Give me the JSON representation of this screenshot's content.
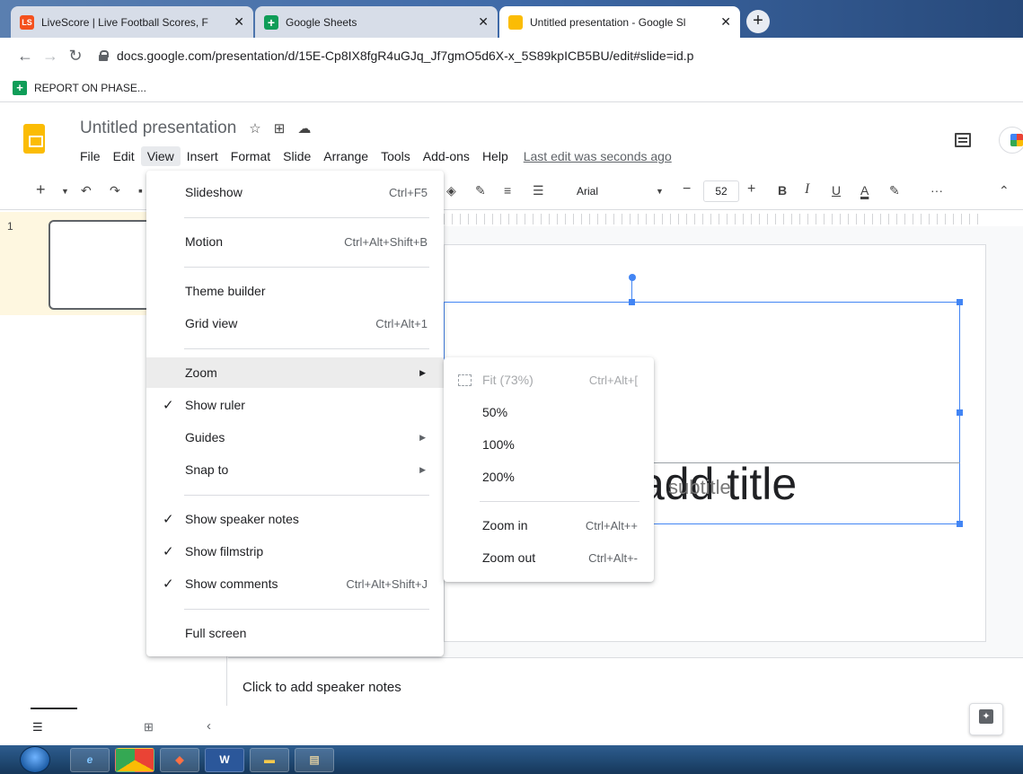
{
  "browser": {
    "tabs": [
      {
        "favicon": "LS",
        "title": "LiveScore | Live Football Scores, F",
        "favicon_color": "#f4511e"
      },
      {
        "favicon": "+",
        "title": "Google Sheets",
        "favicon_color": "#0f9d58"
      },
      {
        "favicon": "",
        "title": "Untitled presentation - Google Sl",
        "favicon_color": "#fbbc04"
      }
    ],
    "close_glyph": "✕",
    "new_tab_glyph": "+",
    "url": "docs.google.com/presentation/d/15E-Cp8IX8fgR4uGJq_Jf7gmO5d6X-x_5S89kpICB5BU/edit#slide=id.p",
    "bookmark": "REPORT ON PHASE..."
  },
  "app": {
    "doc_title": "Untitled presentation",
    "menu": [
      "File",
      "Edit",
      "View",
      "Insert",
      "Format",
      "Slide",
      "Arrange",
      "Tools",
      "Add-ons",
      "Help"
    ],
    "last_edit": "Last edit was seconds ago"
  },
  "toolbar": {
    "font": "Arial",
    "font_size": "52",
    "more": "···"
  },
  "filmstrip": {
    "slide_number": "1"
  },
  "slide": {
    "title_placeholder": "add title",
    "subtitle_placeholder": "subtitle"
  },
  "notes": {
    "placeholder": "Click to add speaker notes"
  },
  "view_menu": {
    "items": [
      {
        "label": "Slideshow",
        "shortcut": "Ctrl+F5"
      },
      {
        "label": "Motion",
        "shortcut": "Ctrl+Alt+Shift+B"
      },
      {
        "label": "Theme builder",
        "shortcut": ""
      },
      {
        "label": "Grid view",
        "shortcut": "Ctrl+Alt+1"
      },
      {
        "label": "Zoom",
        "shortcut": ""
      },
      {
        "label": "Show ruler",
        "shortcut": "",
        "checked": true
      },
      {
        "label": "Guides",
        "shortcut": ""
      },
      {
        "label": "Snap to",
        "shortcut": ""
      },
      {
        "label": "Show speaker notes",
        "shortcut": "",
        "checked": true
      },
      {
        "label": "Show filmstrip",
        "shortcut": "",
        "checked": true
      },
      {
        "label": "Show comments",
        "shortcut": "Ctrl+Alt+Shift+J",
        "checked": true
      },
      {
        "label": "Full screen",
        "shortcut": ""
      }
    ]
  },
  "zoom_menu": {
    "items": [
      {
        "label": "Fit (73%)",
        "shortcut": "Ctrl+Alt+[",
        "disabled": true
      },
      {
        "label": "50%",
        "shortcut": ""
      },
      {
        "label": "100%",
        "shortcut": ""
      },
      {
        "label": "200%",
        "shortcut": ""
      },
      {
        "label": "Zoom in",
        "shortcut": "Ctrl+Alt++"
      },
      {
        "label": "Zoom out",
        "shortcut": "Ctrl+Alt+-"
      }
    ]
  }
}
